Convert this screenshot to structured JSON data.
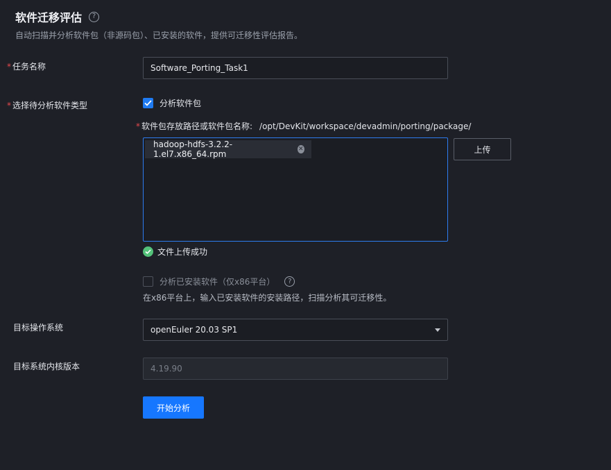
{
  "header": {
    "title": "软件迁移评估",
    "help_glyph": "?",
    "subtitle": "自动扫描并分析软件包（非源码包）、已安装的软件，提供可迁移性评估报告。"
  },
  "form": {
    "required_mark": "*",
    "task_name": {
      "label": "任务名称",
      "value": "Software_Porting_Task1"
    },
    "software_type": {
      "label": "选择待分析软件类型",
      "package_option": {
        "label": "分析软件包",
        "checked": true
      },
      "path_label": "软件包存放路径或软件包名称:",
      "path_value": "/opt/DevKit/workspace/devadmin/porting/package/",
      "files": [
        {
          "name": "hadoop-hdfs-3.2.2-1.el7.x86_64.rpm"
        }
      ],
      "file_remove_glyph": "✕",
      "upload_button": "上传",
      "upload_status": "文件上传成功",
      "installed_option": {
        "label": "分析已安装软件（仅x86平台）",
        "checked": false,
        "help_glyph": "?"
      },
      "installed_note": "在x86平台上，输入已安装软件的安装路径，扫描分析其可迁移性。"
    },
    "target_os": {
      "label": "目标操作系统",
      "value": "openEuler 20.03 SP1"
    },
    "kernel_version": {
      "label": "目标系统内核版本",
      "value": "4.19.90"
    },
    "submit_button": "开始分析"
  },
  "colors": {
    "background": "#1e2027",
    "primary": "#1677ff",
    "required": "#e5484d",
    "success": "#54c27a"
  }
}
